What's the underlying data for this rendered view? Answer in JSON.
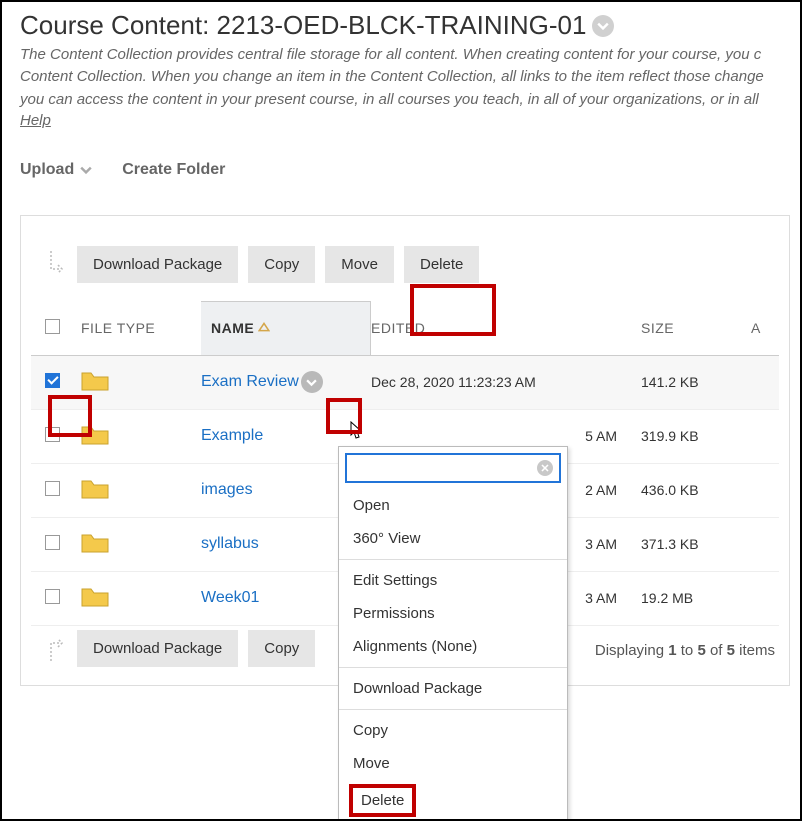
{
  "pageTitle": "Course Content: 2213-OED-BLCK-TRAINING-01",
  "descLine1": "The Content Collection provides central file storage for all content. When creating content for your course, you c",
  "descLine2": "Content Collection. When you change an item in the Content Collection, all links to the item reflect those change",
  "descLine3": "you can access the content in your present course, in all courses you teach, in all of your organizations, or in all",
  "helpLabel": "Help",
  "uploadLabel": "Upload",
  "createFolderLabel": "Create Folder",
  "actions": {
    "downloadPackage": "Download Package",
    "copy": "Copy",
    "move": "Move",
    "delete": "Delete"
  },
  "columns": {
    "fileType": "FILE TYPE",
    "name": "NAME",
    "edited": "EDITED",
    "size": "SIZE",
    "actions": "A"
  },
  "rows": [
    {
      "name": "Exam Review",
      "edited": "Dec 28, 2020 11:23:23 AM",
      "size": "141.2 KB",
      "checked": true
    },
    {
      "name": "Example",
      "edited": "5 AM",
      "size": "319.9 KB",
      "checked": false
    },
    {
      "name": "images",
      "edited": "2 AM",
      "size": "436.0 KB",
      "checked": false
    },
    {
      "name": "syllabus",
      "edited": "3 AM",
      "size": "371.3 KB",
      "checked": false
    },
    {
      "name": "Week01",
      "edited": "3 AM",
      "size": "19.2 MB",
      "checked": false
    }
  ],
  "contextMenu": {
    "open": "Open",
    "view360": "360° View",
    "editSettings": "Edit Settings",
    "permissions": "Permissions",
    "alignments": "Alignments (None)",
    "downloadPackage": "Download Package",
    "copy": "Copy",
    "move": "Move",
    "delete": "Delete"
  },
  "pagingPrefix": "Displaying ",
  "pagingFrom": "1",
  "pagingTo": " to ",
  "pagingToNum": "5",
  "pagingOf": " of ",
  "pagingTotal": "5",
  "pagingSuffix": " items"
}
